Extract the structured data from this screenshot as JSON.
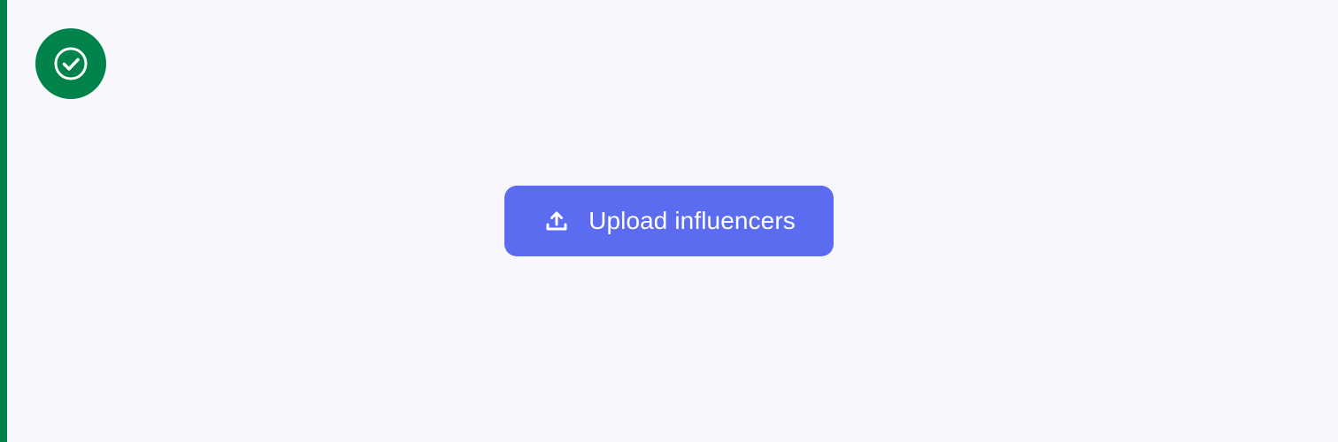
{
  "status": {
    "icon": "check-circle-icon",
    "color": "#00834a"
  },
  "upload_button": {
    "label": "Upload influencers",
    "icon": "upload-icon",
    "color": "#5b6cf0",
    "text_color": "#ffffff"
  },
  "page": {
    "background": "#f8f8fc",
    "accent_border": "#00834a"
  }
}
